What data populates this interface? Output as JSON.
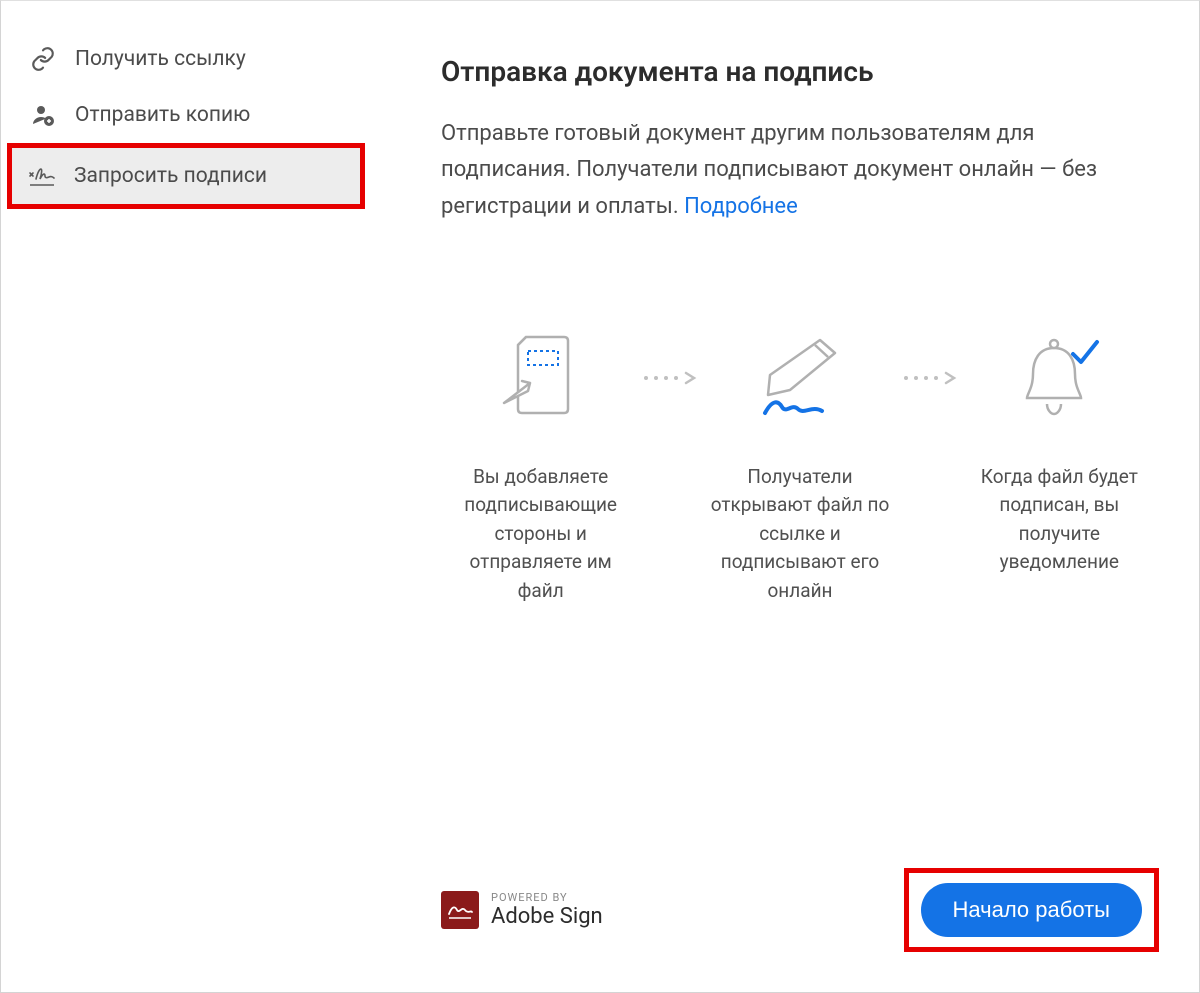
{
  "sidebar": {
    "items": [
      {
        "label": "Получить ссылку"
      },
      {
        "label": "Отправить копию"
      },
      {
        "label": "Запросить подписи"
      }
    ]
  },
  "main": {
    "title": "Отправка документа на подпись",
    "description_part1": "Отправьте готовый документ другим пользователям для подписания. Получатели подписывают документ онлайн — без регистрации и оплаты. ",
    "description_link": "Подробнее"
  },
  "steps": [
    {
      "text": "Вы добавляете подписывающие стороны и отправляете им файл"
    },
    {
      "text": "Получатели открывают файл по ссылке и подписывают его онлайн"
    },
    {
      "text": "Когда файл будет подписан, вы получите уведомление"
    }
  ],
  "footer": {
    "powered_top": "POWERED BY",
    "powered_bottom": "Adobe Sign",
    "start_label": "Начало работы"
  }
}
